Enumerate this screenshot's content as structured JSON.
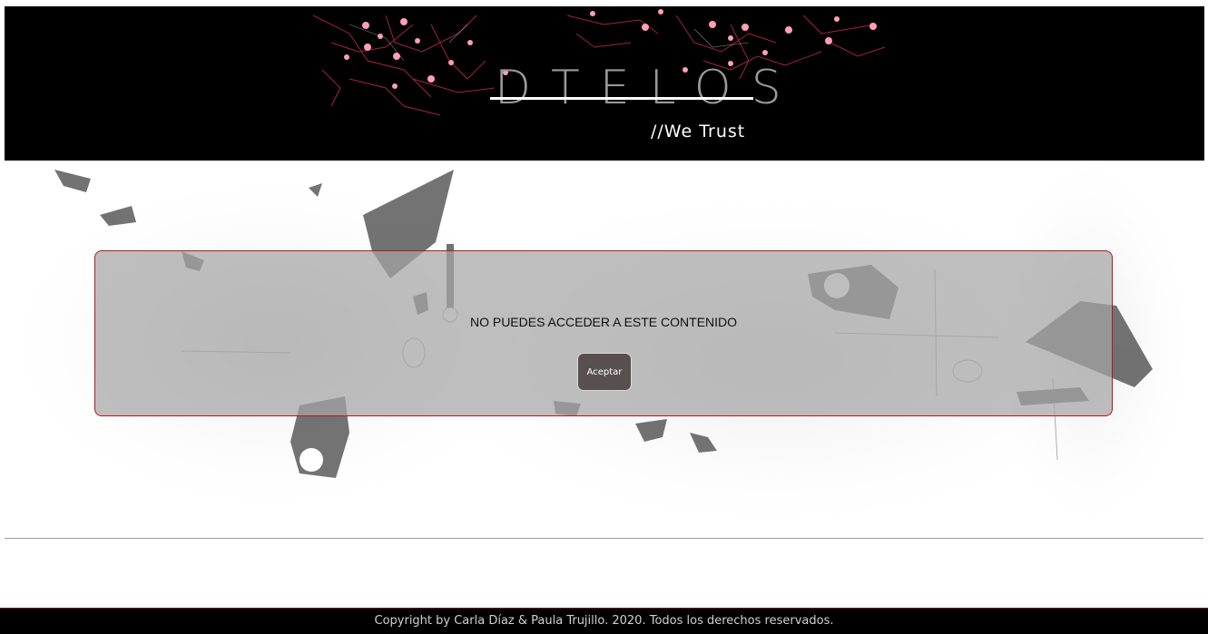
{
  "header": {
    "logo_text": "DTELOS",
    "tagline": "//We Trust"
  },
  "modal": {
    "message": "NO PUEDES ACCEDER A ESTE CONTENIDO",
    "accept_label": "Aceptar"
  },
  "footer": {
    "copyright": "Copyright by Carla Díaz & Paula Trujillo. 2020. Todos los derechos reservados."
  },
  "colors": {
    "header_bg": "#000000",
    "accent": "#b3181e",
    "circuit_pink": "#e0406a",
    "button_bg": "#57504f"
  }
}
